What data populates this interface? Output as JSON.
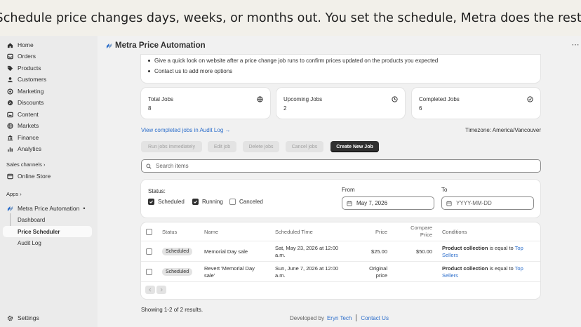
{
  "banner": {
    "text": "Schedule price changes days, weeks, or months out. You set the schedule, Metra does the rest."
  },
  "sidebar": {
    "items": [
      {
        "label": "Home",
        "icon": "home-icon"
      },
      {
        "label": "Orders",
        "icon": "orders-icon"
      },
      {
        "label": "Products",
        "icon": "tag-icon"
      },
      {
        "label": "Customers",
        "icon": "person-icon"
      },
      {
        "label": "Marketing",
        "icon": "target-icon"
      },
      {
        "label": "Discounts",
        "icon": "discount-icon"
      },
      {
        "label": "Content",
        "icon": "content-icon"
      },
      {
        "label": "Markets",
        "icon": "globe-icon"
      },
      {
        "label": "Finance",
        "icon": "bank-icon"
      },
      {
        "label": "Analytics",
        "icon": "chart-icon"
      }
    ],
    "sales_channels_label": "Sales channels",
    "online_store": "Online Store",
    "apps_label": "Apps",
    "app_name": "Metra Price Automation",
    "app_pages": [
      "Dashboard",
      "Price Scheduler",
      "Audit Log"
    ],
    "settings": "Settings"
  },
  "header": {
    "title": "Metra Price Automation",
    "more": "⋯"
  },
  "info": {
    "lines": [
      "Give a quick look on website after a price change job runs to confirm prices updated on the products you expected",
      "Contact us to add more options"
    ]
  },
  "stats": [
    {
      "label": "Total Jobs",
      "value": "8",
      "icon": "globe-icon"
    },
    {
      "label": "Upcoming Jobs",
      "value": "2",
      "icon": "clock-icon"
    },
    {
      "label": "Completed Jobs",
      "value": "6",
      "icon": "check-circle-icon"
    }
  ],
  "audit_link": "View completed jobs in Audit Log →",
  "timezone": "Timezone: America/Vancouver",
  "actions": {
    "run": "Run jobs immediately",
    "edit": "Edit job",
    "delete": "Delete jobs",
    "cancel": "Cancel jobs",
    "create": "Create New Job"
  },
  "search": {
    "placeholder": "Search items"
  },
  "filters": {
    "status_label": "Status:",
    "options": [
      {
        "label": "Scheduled",
        "checked": true
      },
      {
        "label": "Running",
        "checked": true
      },
      {
        "label": "Canceled",
        "checked": false
      }
    ],
    "from_label": "From",
    "from_value": "May 7, 2026",
    "to_label": "To",
    "to_placeholder": "YYYY-MM-DD"
  },
  "table": {
    "headers": {
      "status": "Status",
      "name": "Name",
      "scheduled_time": "Scheduled Time",
      "price": "Price",
      "compare_price_1": "Compare",
      "compare_price_2": "Price",
      "conditions": "Conditions"
    },
    "rows": [
      {
        "status": "Scheduled",
        "name_1": "Memorial Day sale",
        "name_2": "",
        "time_1": "Sat, May 23, 2026 at 12:00",
        "time_2": "a.m.",
        "price_1": "$25.00",
        "price_2": "",
        "compare_price": "$50.00",
        "cond_field": "Product collection",
        "cond_op": " is equal to ",
        "cond_value_1": "Top",
        "cond_value_2": "Sellers"
      },
      {
        "status": "Scheduled",
        "name_1": "Revert 'Memorial Day",
        "name_2": "sale'",
        "time_1": "Sun, June 7, 2026 at 12:00",
        "time_2": "a.m.",
        "price_1": "Original",
        "price_2": "price",
        "compare_price": "",
        "cond_field": "Product collection",
        "cond_op": " is equal to ",
        "cond_value_1": "Top",
        "cond_value_2": "Sellers"
      }
    ]
  },
  "results": "Showing 1-2 of 2 results.",
  "footer": {
    "prefix": "Developed by",
    "developer": "Eryn Tech",
    "contact": "Contact Us"
  },
  "colors": {
    "link": "#2c6ecb",
    "primary_button": "#303030",
    "sidebar_bg": "#ebebeb",
    "banner_bg": "#f2f0ea"
  }
}
